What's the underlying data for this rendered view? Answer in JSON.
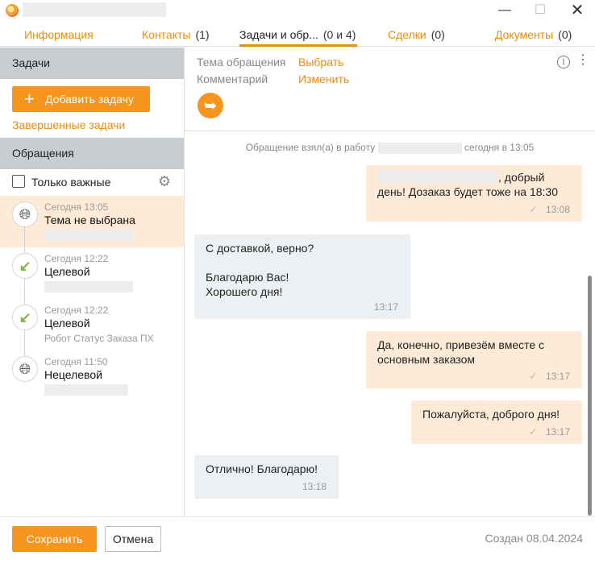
{
  "window": {
    "close_glyph": "✕",
    "min_glyph": "—",
    "max_glyph": "☐"
  },
  "tabs": [
    {
      "label": "Информация",
      "count": ""
    },
    {
      "label": "Контакты",
      "count": "(1)"
    },
    {
      "label": "Задачи и обр...",
      "count": "(0 и 4)"
    },
    {
      "label": "Сделки",
      "count": "(0)"
    },
    {
      "label": "Документы",
      "count": "(0)"
    }
  ],
  "sidebar": {
    "tasks_header": "Задачи",
    "add_task_label": "Добавить задачу",
    "completed_link": "Завершенные задачи",
    "appeals_header": "Обращения",
    "only_important_label": "Только важные",
    "appeals": [
      {
        "time": "Сегодня 13:05",
        "title": "Тема не выбрана",
        "subtitle": "",
        "icon": "globe-icon"
      },
      {
        "time": "Сегодня 12:22",
        "title": "Целевой",
        "subtitle": "",
        "icon": "incoming-arrow-icon"
      },
      {
        "time": "Сегодня 12:22",
        "title": "Целевой",
        "subtitle": "Робот Статус Заказа ПХ",
        "icon": "incoming-arrow-icon"
      },
      {
        "time": "Сегодня 11:50",
        "title": "Нецелевой",
        "subtitle": "",
        "icon": "globe-icon"
      }
    ]
  },
  "detail": {
    "topic_label": "Тема обращения",
    "topic_action": "Выбрать",
    "comment_label": "Комментарий",
    "comment_action": "Изменить"
  },
  "chat": {
    "system_prefix": "Обращение взял(а) в работу",
    "system_suffix": "сегодня в 13:05",
    "messages": [
      {
        "direction": "out",
        "text": ", добрый\nдень! Дозаказ будет тоже на 18:30",
        "time": "13:08"
      },
      {
        "direction": "in",
        "text": "С доставкой, верно?\n\nБлагодарю Вас!\nХорошего дня!",
        "time": "13:17"
      },
      {
        "direction": "out",
        "text": "Да, конечно, привезём вместе с\nосновным заказом",
        "time": "13:17"
      },
      {
        "direction": "out",
        "text": "Пожалуйста, доброго дня!",
        "time": "13:17"
      },
      {
        "direction": "in",
        "text": "Отлично! Благодарю!",
        "time": "13:18"
      }
    ]
  },
  "footer": {
    "save_label": "Сохранить",
    "cancel_label": "Отмена",
    "created_text": "Создан 08.04.2024"
  },
  "colors": {
    "accent": "#f7941d",
    "link": "#ee8a0a",
    "outgoing_bubble": "#fdebd8",
    "incoming_bubble": "#edf0f2",
    "section_header": "#c7cdd1"
  }
}
